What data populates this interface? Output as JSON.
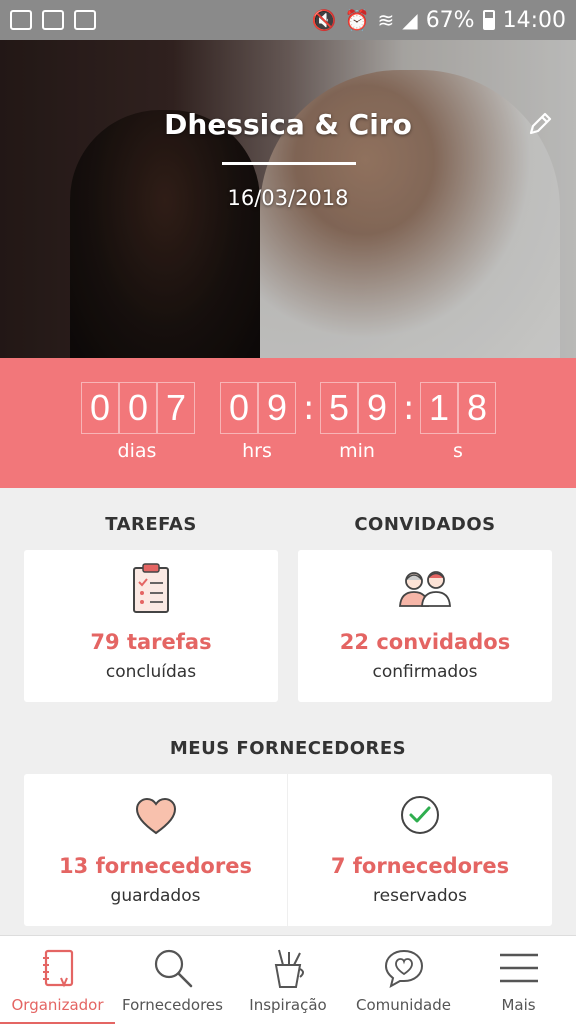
{
  "status_bar": {
    "battery": "67%",
    "time": "14:00"
  },
  "header": {
    "couple_names": "Dhessica & Ciro",
    "date": "16/03/2018",
    "edit_icon": "pencil-icon"
  },
  "countdown": {
    "days_digits": [
      "0",
      "0",
      "7"
    ],
    "hours_digits": [
      "0",
      "9"
    ],
    "minutes_digits": [
      "5",
      "9"
    ],
    "seconds_digits": [
      "1",
      "8"
    ],
    "separator": ":",
    "days_label": "dias",
    "hours_label": "hrs",
    "minutes_label": "min",
    "seconds_label": "s"
  },
  "tasks": {
    "title": "TAREFAS",
    "count": "79 tarefas",
    "sub": "concluídas",
    "icon": "clipboard-icon"
  },
  "guests": {
    "title": "CONVIDADOS",
    "count": "22 convidados",
    "sub": "confirmados",
    "icon": "guests-icon"
  },
  "vendors": {
    "title": "MEUS FORNECEDORES",
    "saved_count": "13 fornecedores",
    "saved_sub": "guardados",
    "saved_icon": "heart-icon",
    "booked_count": "7 fornecedores",
    "booked_sub": "reservados",
    "booked_icon": "check-circle-icon"
  },
  "bottom_nav": {
    "items": [
      {
        "label": "Organizador",
        "icon": "notebook-icon",
        "active": true
      },
      {
        "label": "Fornecedores",
        "icon": "search-icon",
        "active": false
      },
      {
        "label": "Inspiração",
        "icon": "pencil-cup-icon",
        "active": false
      },
      {
        "label": "Comunidade",
        "icon": "chat-heart-icon",
        "active": false
      },
      {
        "label": "Mais",
        "icon": "menu-icon",
        "active": false
      }
    ]
  },
  "colors": {
    "accent": "#f2777a",
    "accent_text": "#e46563",
    "status_bar": "#8a8a8a",
    "background": "#efefef"
  }
}
